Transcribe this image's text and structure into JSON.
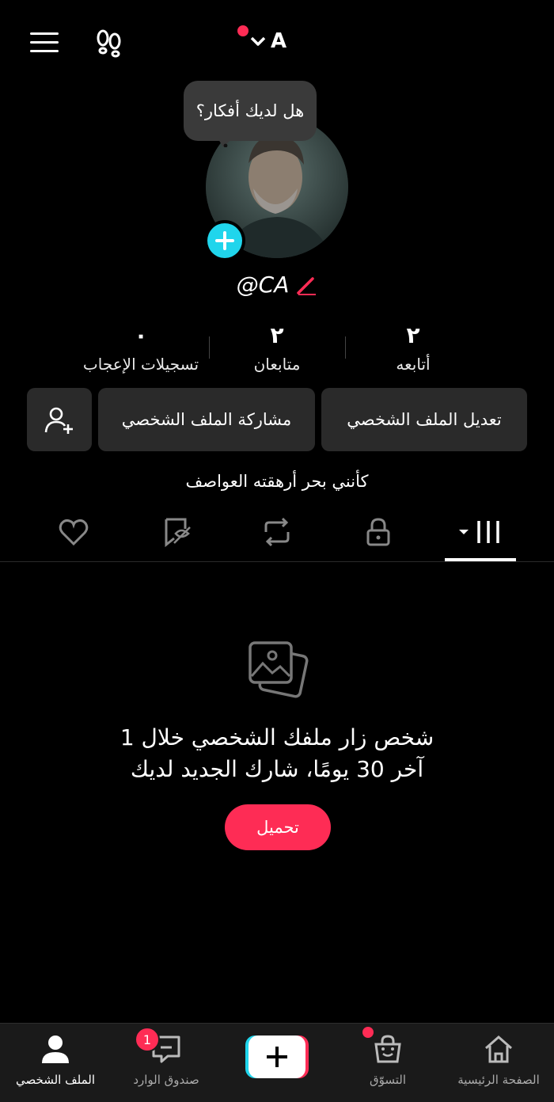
{
  "header": {
    "account_name": "A",
    "menu_icon": "hamburger-menu-icon",
    "footprint_icon": "footprints-icon",
    "notification_dot_color": "#fe2c55"
  },
  "profile": {
    "tooltip": "هل لديك أفكار؟",
    "username": "@CA",
    "bio": "كأنني بحر أرهقته العواصف"
  },
  "stats": [
    {
      "count": "٢",
      "label": "أتابعه"
    },
    {
      "count": "٢",
      "label": "متابعان"
    },
    {
      "count": "٠",
      "label": "تسجيلات الإعجاب"
    }
  ],
  "actions": {
    "edit_profile": "تعديل الملف الشخصي",
    "share_profile": "مشاركة الملف الشخصي",
    "add_friend_icon": "add-user-icon"
  },
  "tabs": [
    {
      "icon": "videos-grid-icon",
      "active": true
    },
    {
      "icon": "lock-icon"
    },
    {
      "icon": "repost-icon"
    },
    {
      "icon": "bookmark-icon"
    },
    {
      "icon": "heart-icon"
    }
  ],
  "empty_state": {
    "line1": "1 شخص زار ملفك الشخصي خلال",
    "line2": "آخر 30 يومًا، شارك الجديد لديك",
    "upload_button": "تحميل"
  },
  "bottom_nav": {
    "home": "الصفحة الرئيسية",
    "shop": "التسوّق",
    "inbox": "صندوق الوارد",
    "inbox_badge": "1",
    "profile": "الملف الشخصي"
  },
  "colors": {
    "accent": "#fe2c55",
    "cyan": "#20d5ec",
    "background": "#000000"
  }
}
